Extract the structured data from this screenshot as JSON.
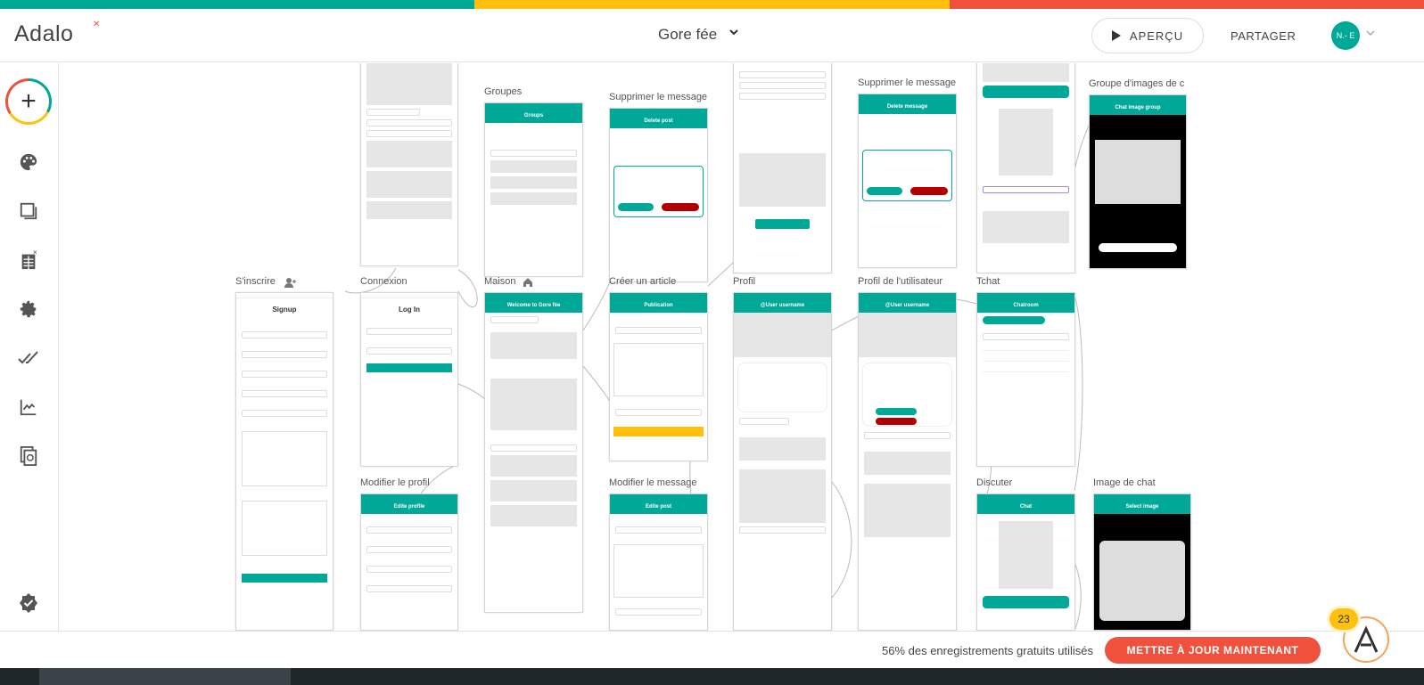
{
  "colors": {
    "teal": "#00a898",
    "yellow": "#ffc00e",
    "red": "#f0513c"
  },
  "header": {
    "logo": "Adalo",
    "app_name": "Gore fée",
    "preview_label": "APERÇU",
    "share_label": "PARTAGER",
    "avatar_initials": "N.-\nE"
  },
  "sidebar": {
    "items": [
      {
        "icon": "add-icon"
      },
      {
        "icon": "palette-icon"
      },
      {
        "icon": "screens-icon"
      },
      {
        "icon": "database-icon"
      },
      {
        "icon": "gear-icon"
      },
      {
        "icon": "checks-icon"
      },
      {
        "icon": "analytics-icon"
      },
      {
        "icon": "publish-icon"
      },
      {
        "icon": "verified-icon"
      }
    ]
  },
  "screens": [
    {
      "label": "Groupes",
      "title": "Groups"
    },
    {
      "label": "Supprimer le message",
      "title": "Delete post"
    },
    {
      "label": "Supprimer le message",
      "title": "Delete message"
    },
    {
      "label": "Groupe d'images de c",
      "title": "Chat image group"
    },
    {
      "label": "S'inscrire",
      "title": "Signup"
    },
    {
      "label": "Connexion",
      "title": "Log In"
    },
    {
      "label": "Maison",
      "title": "Welcome to Gore fée"
    },
    {
      "label": "Créer un article",
      "title": "Publication"
    },
    {
      "label": "Profil",
      "title": "@User username"
    },
    {
      "label": "Profil de l'utilisateur",
      "title": "@User username"
    },
    {
      "label": "Tchat",
      "title": "Chatroom"
    },
    {
      "label": "Modifier le profil",
      "title": "Edite profile"
    },
    {
      "label": "Modifier le message",
      "title": "Edite post"
    },
    {
      "label": "Discuter",
      "title": "Chat"
    },
    {
      "label": "Image de chat",
      "title": "Select image"
    }
  ],
  "footer": {
    "usage_text": "56% des enregistrements gratuits utilisés",
    "upgrade_label": "METTRE À JOUR MAINTENANT",
    "badge_count": "23"
  }
}
